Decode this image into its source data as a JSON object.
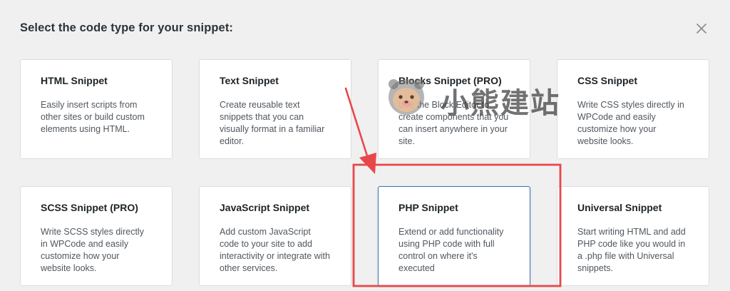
{
  "dialog": {
    "title": "Select the code type for your snippet:"
  },
  "cards": [
    {
      "title": "HTML Snippet",
      "description": "Easily insert scripts from other sites or build custom elements using HTML."
    },
    {
      "title": "Text Snippet",
      "description": "Create reusable text snippets that you can visually format in a familiar editor."
    },
    {
      "title": "Blocks Snippet (PRO)",
      "description": "Use the Block Editor to create components that you can insert anywhere in your site."
    },
    {
      "title": "CSS Snippet",
      "description": "Write CSS styles directly in WPCode and easily customize how your website looks."
    },
    {
      "title": "SCSS Snippet (PRO)",
      "description": "Write SCSS styles directly in WPCode and easily customize how your website looks."
    },
    {
      "title": "JavaScript Snippet",
      "description": "Add custom JavaScript code to your site to add interactivity or integrate with other services."
    },
    {
      "title": "PHP Snippet",
      "description": "Extend or add functionality using PHP code with full control on where it's executed"
    },
    {
      "title": "Universal Snippet",
      "description": "Start writing HTML and add PHP code like you would in a .php file with Universal snippets."
    }
  ],
  "selected_card": "PHP Snippet",
  "watermark": {
    "text": "小熊建站"
  },
  "colors": {
    "background": "#f0f0f1",
    "card_border": "#dcdcde",
    "selected_border": "#3f6fb5",
    "annotation_red": "#e8474a"
  },
  "icons": {
    "close": "close-icon",
    "watermark_logo": "bear-logo-icon"
  }
}
